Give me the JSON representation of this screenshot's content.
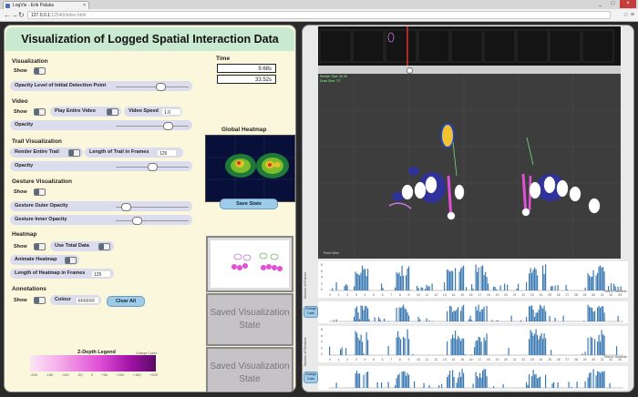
{
  "browser": {
    "tab_title": "LogVis - Erik Paluka",
    "tab_close": "×",
    "url_host": "127.0.0.1",
    "url_path": ":12540/index.html",
    "back": "←",
    "forward": "→",
    "reload": "↻",
    "star": "☆",
    "menu": "≡",
    "minimize": "_",
    "maximize": "□",
    "close": "×"
  },
  "title": "Visualization of Logged Spatial Interaction Data",
  "visualization": {
    "heading": "Visualization",
    "show_label": "Show",
    "opacity_label": "Opacity Level of Initial Detection Point",
    "opacity_value": 0.7
  },
  "video": {
    "heading": "Video",
    "show_label": "Show",
    "play_label": "Play Entire Video",
    "speed_label": "Video Speed",
    "speed_value": "1.0",
    "opacity_label": "Opacity",
    "opacity_value": 0.65
  },
  "trail": {
    "heading": "Trail Visualization",
    "render_label": "Render Entire Trail",
    "length_label": "Length of Trail in Frames",
    "length_value": "125",
    "opacity_label": "Opacity",
    "opacity_value": 0.5
  },
  "gesture": {
    "heading": "Gesture Visualization",
    "show_label": "Show",
    "outer_label": "Gesture Outer Opacity",
    "outer_value": 0.1,
    "inner_label": "Gesture Inner Opacity",
    "inner_value": 0.2
  },
  "heatmap": {
    "heading": "Heatmap",
    "show_label": "Show",
    "total_label": "Use Total Data",
    "animate_label": "Animate Heatmap",
    "length_label": "Length of Heatmap in Frames",
    "length_value": "125"
  },
  "annotations": {
    "heading": "Annotations",
    "show_label": "Show",
    "colour_label": "Colour",
    "colour_value": "FFFFFF",
    "clear_label": "Clear All"
  },
  "time": {
    "heading": "Time",
    "current": "9.68s",
    "total": "33.52s"
  },
  "global_heatmap_label": "Global Heatmap",
  "save_state_label": "Save State",
  "saved_states": [
    "Saved Visualization State",
    "Saved Visualization State"
  ],
  "legend": {
    "title": "Z-Depth Legend",
    "change_colour": "Change Colour",
    "ticks": [
      "-200",
      "-150",
      "-100",
      "-50",
      "0",
      "+50",
      "+100",
      "+150",
      "+200"
    ]
  },
  "charts": {
    "frames_label": "Number of Frames",
    "gestures_label": "Number of Gestures",
    "x_label": "Time in Seconds",
    "change_data": "Change Data",
    "y_ticks": [
      "8",
      "6",
      "4",
      "2",
      "0"
    ],
    "x_ticks": [
      "0",
      "1",
      "2",
      "3",
      "4",
      "5",
      "6",
      "7",
      "8",
      "9",
      "10",
      "11",
      "12",
      "13",
      "14",
      "15",
      "16",
      "17",
      "18",
      "19",
      "20",
      "21",
      "22",
      "23",
      "24",
      "25",
      "26",
      "27",
      "28",
      "29",
      "30",
      "31",
      "32",
      "33"
    ]
  },
  "video_overlay": {
    "top_text": "Render Size: 30.90",
    "top_text2": "Draw Size: 7/7",
    "bottom_text": "Front View"
  },
  "colors": {
    "title_bg": "#c9ead1",
    "panel_bg": "#fbf7dc",
    "bar": "#3c7ab4",
    "accent_pink": "#e14fd6"
  }
}
